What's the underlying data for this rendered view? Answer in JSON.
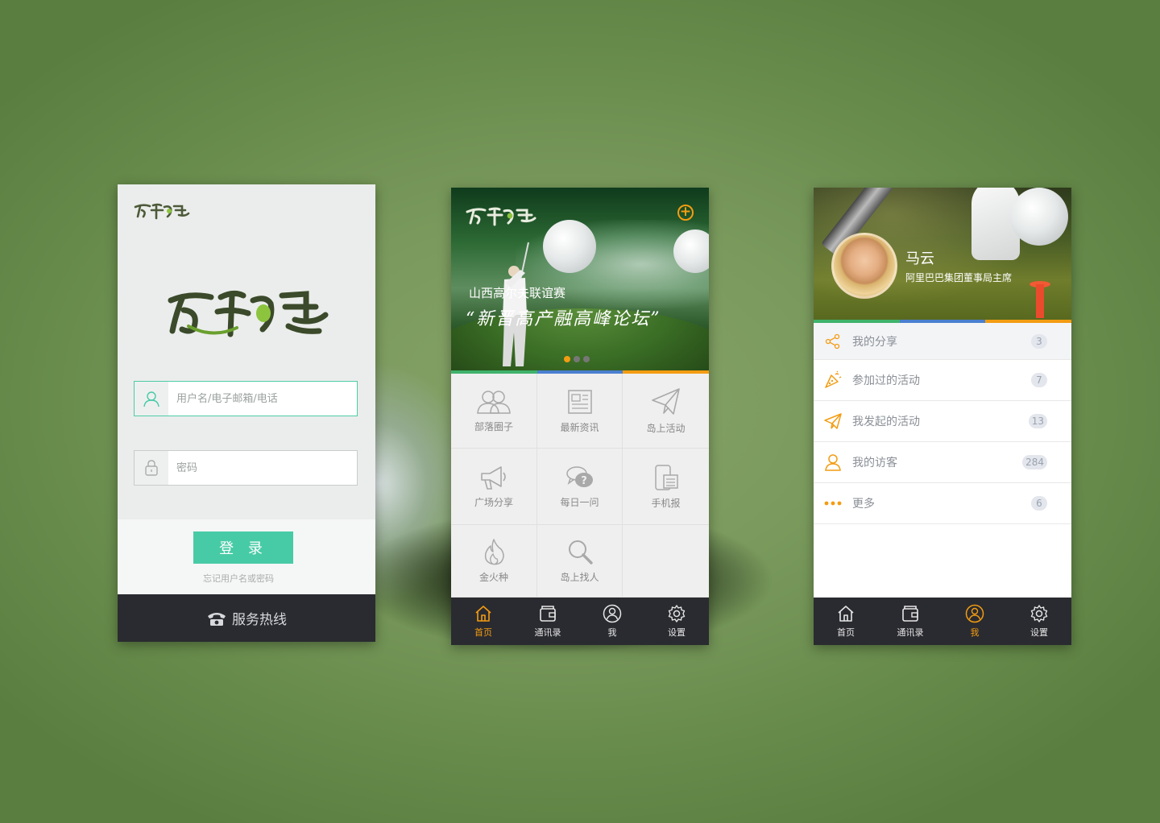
{
  "login": {
    "username_placeholder": "用户名/电子邮箱/电话",
    "password_placeholder": "密码",
    "login_label": "登 录",
    "forgot_label": "忘记用户名或密码",
    "hotline_label": "服务热线"
  },
  "home": {
    "banner_subtitle": "山西高尔夫联谊赛",
    "banner_title": "“新晋高产融高峰论坛”",
    "banner_add_label": "+",
    "grid": [
      {
        "label": "部落圈子",
        "icon": "people-icon"
      },
      {
        "label": "最新资讯",
        "icon": "news-icon"
      },
      {
        "label": "岛上活动",
        "icon": "paper-plane-icon"
      },
      {
        "label": "广场分享",
        "icon": "megaphone-icon"
      },
      {
        "label": "每日一问",
        "icon": "question-bubble-icon"
      },
      {
        "label": "手机报",
        "icon": "mobile-news-icon"
      },
      {
        "label": "金火种",
        "icon": "flame-icon"
      },
      {
        "label": "岛上找人",
        "icon": "magnifier-icon"
      }
    ],
    "tabs": [
      {
        "label": "首页",
        "icon": "home-icon"
      },
      {
        "label": "通讯录",
        "icon": "contacts-icon"
      },
      {
        "label": "我",
        "icon": "user-icon"
      },
      {
        "label": "设置",
        "icon": "gear-icon"
      }
    ],
    "active_tab": "首页"
  },
  "profile": {
    "name": "马云",
    "title": "阿里巴巴集团董事局主席",
    "menu": [
      {
        "label": "我的分享",
        "count": "3",
        "icon": "share-icon"
      },
      {
        "label": "参加过的活动",
        "count": "7",
        "icon": "party-cone-icon"
      },
      {
        "label": "我发起的活动",
        "count": "13",
        "icon": "paper-plane-icon"
      },
      {
        "label": "我的访客",
        "count": "284",
        "icon": "visitor-icon"
      },
      {
        "label": "更多",
        "count": "6",
        "icon": "more-dots-icon"
      }
    ],
    "tabs": [
      {
        "label": "首页",
        "icon": "home-icon"
      },
      {
        "label": "通讯录",
        "icon": "contacts-icon"
      },
      {
        "label": "我",
        "icon": "user-icon"
      },
      {
        "label": "设置",
        "icon": "gear-icon"
      }
    ],
    "active_tab": "我"
  },
  "colors": {
    "accent_green": "#47cba6",
    "accent_orange": "#f39c12",
    "bar_green": "#3fb36b",
    "bar_blue": "#4a7fd0",
    "bar_orange": "#f39c12",
    "tabbar_bg": "#2a2b30"
  }
}
